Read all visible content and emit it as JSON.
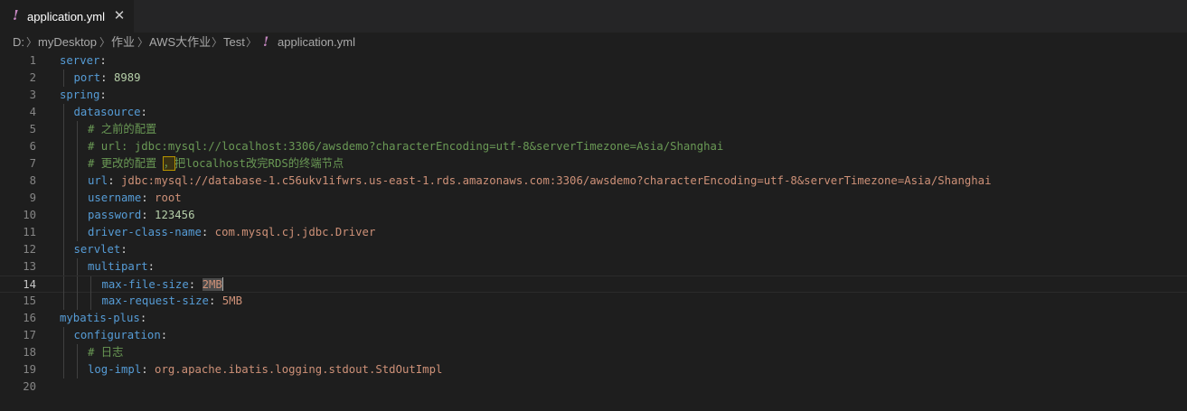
{
  "tab": {
    "warn_glyph": "!",
    "title": "application.yml",
    "close_glyph": "✕"
  },
  "breadcrumb": {
    "items": [
      "D:",
      "myDesktop",
      "作业",
      "AWS大作业",
      "Test",
      "application.yml"
    ],
    "separator": "〉",
    "file_warn_glyph": "!"
  },
  "editor": {
    "current_line": 14,
    "lines": [
      {
        "num": "1",
        "tokens": [
          {
            "t": "k",
            "v": "server"
          },
          {
            "t": "p",
            "v": ":"
          }
        ]
      },
      {
        "num": "2",
        "tokens": [
          {
            "t": "k",
            "v": "port"
          },
          {
            "t": "p",
            "v": ": "
          },
          {
            "t": "n",
            "v": "8989"
          }
        ]
      },
      {
        "num": "3",
        "tokens": [
          {
            "t": "k",
            "v": "spring"
          },
          {
            "t": "p",
            "v": ":"
          }
        ]
      },
      {
        "num": "4",
        "tokens": [
          {
            "t": "k",
            "v": "datasource"
          },
          {
            "t": "p",
            "v": ":"
          }
        ]
      },
      {
        "num": "5",
        "tokens": [
          {
            "t": "c",
            "v": "# 之前的配置"
          }
        ]
      },
      {
        "num": "6",
        "tokens": [
          {
            "t": "c",
            "v": "# url: jdbc:mysql://localhost:3306/awsdemo?characterEncoding=utf-8&serverTimezone=Asia/Shanghai"
          }
        ]
      },
      {
        "num": "7",
        "tokens": [
          {
            "t": "c",
            "v": "# 更改的配置 "
          },
          {
            "t": "c-box",
            "v": "，"
          },
          {
            "t": "c",
            "v": "把localhost改完RDS的终端节点"
          }
        ]
      },
      {
        "num": "8",
        "tokens": [
          {
            "t": "k",
            "v": "url"
          },
          {
            "t": "p",
            "v": ": "
          },
          {
            "t": "s",
            "v": "jdbc:mysql://database-1.c56ukv1ifwrs.us-east-1.rds.amazonaws.com:3306/awsdemo?characterEncoding=utf-8&serverTimezone=Asia/Shanghai"
          }
        ]
      },
      {
        "num": "9",
        "tokens": [
          {
            "t": "k",
            "v": "username"
          },
          {
            "t": "p",
            "v": ": "
          },
          {
            "t": "s",
            "v": "root"
          }
        ]
      },
      {
        "num": "10",
        "tokens": [
          {
            "t": "k",
            "v": "password"
          },
          {
            "t": "p",
            "v": ": "
          },
          {
            "t": "n",
            "v": "123456"
          }
        ]
      },
      {
        "num": "11",
        "tokens": [
          {
            "t": "k",
            "v": "driver-class-name"
          },
          {
            "t": "p",
            "v": ": "
          },
          {
            "t": "s",
            "v": "com.mysql.cj.jdbc.Driver"
          }
        ]
      },
      {
        "num": "12",
        "tokens": [
          {
            "t": "k",
            "v": "servlet"
          },
          {
            "t": "p",
            "v": ":"
          }
        ]
      },
      {
        "num": "13",
        "tokens": [
          {
            "t": "k",
            "v": "multipart"
          },
          {
            "t": "p",
            "v": ":"
          }
        ]
      },
      {
        "num": "14",
        "tokens": [
          {
            "t": "k",
            "v": "max-file-size"
          },
          {
            "t": "p",
            "v": ": "
          },
          {
            "t": "s-sel",
            "v": "2MB"
          },
          {
            "t": "cursor",
            "v": ""
          }
        ]
      },
      {
        "num": "15",
        "tokens": [
          {
            "t": "k",
            "v": "max-request-size"
          },
          {
            "t": "p",
            "v": ": "
          },
          {
            "t": "s",
            "v": "5MB"
          }
        ]
      },
      {
        "num": "16",
        "tokens": [
          {
            "t": "k",
            "v": "mybatis-plus"
          },
          {
            "t": "p",
            "v": ":"
          }
        ]
      },
      {
        "num": "17",
        "tokens": [
          {
            "t": "k",
            "v": "configuration"
          },
          {
            "t": "p",
            "v": ":"
          }
        ]
      },
      {
        "num": "18",
        "tokens": [
          {
            "t": "c",
            "v": "# 日志"
          }
        ]
      },
      {
        "num": "19",
        "tokens": [
          {
            "t": "k",
            "v": "log-impl"
          },
          {
            "t": "p",
            "v": ": "
          },
          {
            "t": "s",
            "v": "org.apache.ibatis.logging.stdout.StdOutImpl"
          }
        ]
      },
      {
        "num": "20",
        "tokens": []
      }
    ]
  },
  "colors": {
    "background": "#1e1e1e",
    "key": "#569cd6",
    "string": "#ce9178",
    "number": "#b5cea8",
    "comment": "#6a9955",
    "warning": "#c586c0"
  }
}
